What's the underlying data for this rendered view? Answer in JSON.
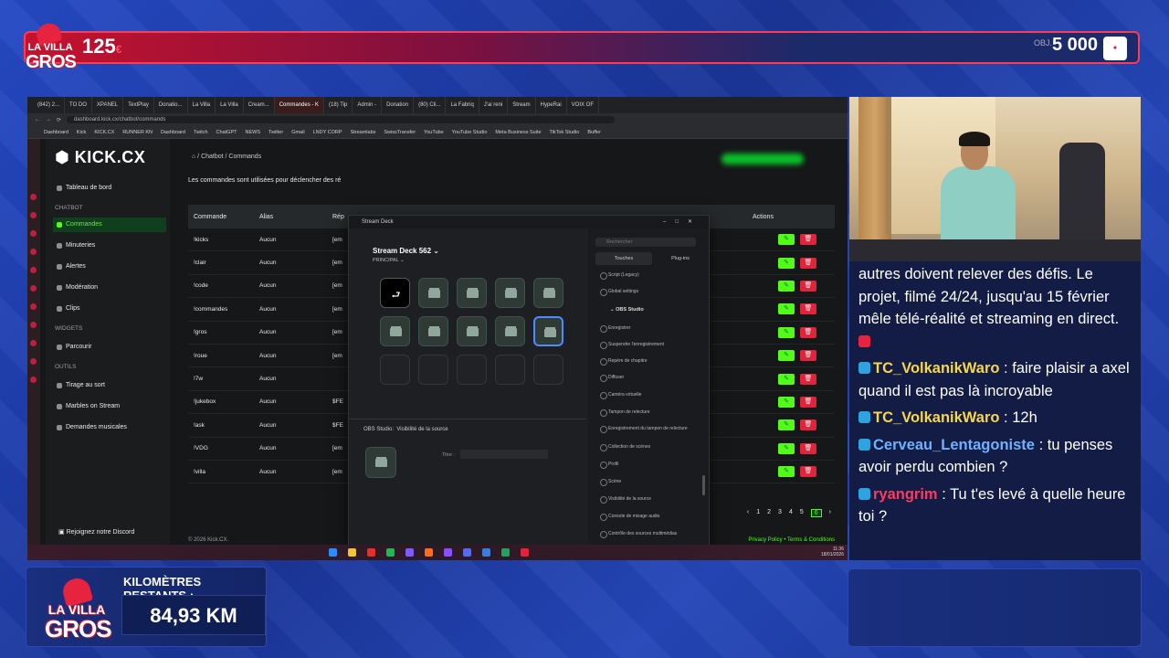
{
  "overlay": {
    "logo_line1": "LA VILLA",
    "logo_line2": "GROS",
    "counter": "125",
    "counter_unit": "€",
    "goal_label": "OBJ.",
    "goal_value": "5 000",
    "goal_unit": "€",
    "km_label": "KILOMÈTRES RESTANTS :",
    "km_value": "84,93 KM"
  },
  "browser": {
    "tabs": [
      "(842) 2...",
      "TO DO",
      "XPANEL",
      "TextPlay",
      "Donatio...",
      "La Villa",
      "La Villa",
      "Cream...",
      "Commandes - K",
      "(18) Tip",
      "Admin -",
      "Donation",
      "(80) Cli...",
      "La Fabriq",
      "J'ai reni",
      "Stream",
      "HypeRai",
      "VOIX OF"
    ],
    "active_tab": "Commandes - K",
    "url": "dashboard.kick.cx/chatbot/commands",
    "bookmarks": [
      "Dashboard",
      "Kick",
      "KICK.CX",
      "RUNNER KN",
      "Dashboard",
      "Twitch",
      "ChatGPT",
      "NEWS",
      "Twitter",
      "Gmail",
      "LNDY CORP",
      "Streamlabs",
      "SwissTransfer",
      "YouTube",
      "YouTube Studio",
      "Meta Business Suite",
      "TikTok Studio",
      "Buffer"
    ]
  },
  "kick": {
    "brand": "KICK.CX",
    "breadcrumb": "⌂  /  Chatbot  /  Commands",
    "dashboard": "Tableau de bord",
    "section_chatbot": "CHATBOT",
    "commandes": "Commandes",
    "minuteries": "Minuteries",
    "alertes": "Alertes",
    "moderation": "Modération",
    "clips": "Clips",
    "section_widgets": "WIDGETS",
    "parcourir": "Parcourir",
    "section_outils": "OUTILS",
    "tirage": "Tirage au sort",
    "marbles": "Marbles on Stream",
    "demandes": "Demandes musicales",
    "discord": "Rejoignez notre Discord",
    "description": "Les commandes sont utilisées pour déclencher des ré",
    "columns": {
      "commande": "Commande",
      "alias": "Alias",
      "reponse": "Rép",
      "actions": "Actions"
    },
    "rows": [
      {
        "cmd": "!kicks",
        "alias": "Aucun",
        "resp": "[em"
      },
      {
        "cmd": "!clair",
        "alias": "Aucun",
        "resp": "[em"
      },
      {
        "cmd": "!code",
        "alias": "Aucun",
        "resp": "[em"
      },
      {
        "cmd": "!commandes",
        "alias": "Aucun",
        "resp": "[em"
      },
      {
        "cmd": "!gros",
        "alias": "Aucun",
        "resp": "[em"
      },
      {
        "cmd": "!roue",
        "alias": "Aucun",
        "resp": "[em"
      },
      {
        "cmd": "!7w",
        "alias": "Aucun",
        "resp": ""
      },
      {
        "cmd": "!jukebox",
        "alias": "Aucun",
        "resp": "$FE"
      },
      {
        "cmd": "!ask",
        "alias": "Aucun",
        "resp": "$FE"
      },
      {
        "cmd": "!VDG",
        "alias": "Aucun",
        "resp": "[em"
      },
      {
        "cmd": "!villa",
        "alias": "Aucun",
        "resp": "[em"
      }
    ],
    "pages": [
      "1",
      "2",
      "3",
      "4",
      "5",
      "6"
    ],
    "current_page": "6",
    "footer": "© 2026 Kick.CX.",
    "footer_links": "Privacy Policy  •  Terms & Conditions"
  },
  "streamdeck": {
    "window_title": "Stream Deck",
    "device": "Stream Deck 562",
    "profile": "PRINCIPAL",
    "search_placeholder": "Rechercher",
    "tab_keys": "Touches",
    "tab_plugins": "Plug-ins",
    "action_scene": "Script (Legacy)",
    "global_settings": "Global settings",
    "group": "OBS Studio",
    "actions": [
      "Enregistrer",
      "Suspendre l'enregistrement",
      "Repère de chapitre",
      "Diffuser",
      "Caméra virtuelle",
      "Tampon de relecture",
      "Enregistrement du tampon de relecture",
      "Collection de scènes",
      "Profil",
      "Scène",
      "Visibilité de la source",
      "Console de mixage audio",
      "Contrôle des sources multimédias"
    ],
    "props_plugin": "OBS Studio:",
    "props_action": "Visibilité de la source",
    "title_label": "Titre :"
  },
  "chat": {
    "intro": "autres doivent relever des défis. Le projet, filmé 24/24, jusqu'au 15 février mêle télé-réalité et streaming en direct.",
    "messages": [
      {
        "user": "TC_VolkanikWaro",
        "text": "faire plaisir a axel quand il est pas là incroyable",
        "color": "#f6d64a"
      },
      {
        "user": "TC_VolkanikWaro",
        "text": "12h",
        "color": "#f6d64a"
      },
      {
        "user": "Cerveau_Lentagoniste",
        "text": "tu penses avoir perdu combien ?",
        "color": "#6fb1ff"
      },
      {
        "user": "ryangrim",
        "text": "Tu t'es levé à quelle heure toi ?",
        "color": "#ff3b5c"
      }
    ]
  },
  "taskbar": {
    "time": "11:36",
    "date": "18/01/2026"
  }
}
